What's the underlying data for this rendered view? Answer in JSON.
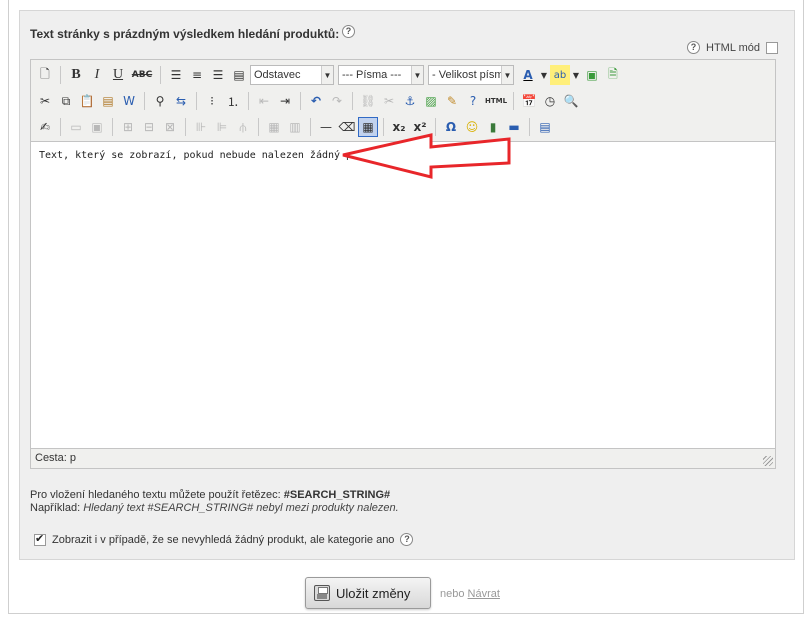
{
  "section": {
    "title": "Text stránky s prázdným výsledkem hledání produktů:",
    "help": "?"
  },
  "html_mode": {
    "label": "HTML mód",
    "help": "?",
    "checked": false
  },
  "toolbar": {
    "format_select": "Odstavec",
    "font_select": "--- Písma ---",
    "size_select": "- Velikost písma -",
    "row1_icons": [
      "new-document-icon",
      "bold-icon",
      "italic-icon",
      "underline-icon",
      "strikethrough-icon",
      "align-left-icon",
      "align-center-icon",
      "align-right-icon",
      "align-justify-icon"
    ],
    "bold_glyph": "B",
    "italic_glyph": "I",
    "underline_glyph": "U",
    "strike_glyph": "ABC"
  },
  "editor": {
    "content": "Text, který se zobrazí, pokud nebude nalezen žádný produkt.",
    "path_label": "Cesta: p"
  },
  "hint": {
    "prefix": "Pro vložení hledaného textu můžete použít řetězec: ",
    "token": "#SEARCH_STRING#",
    "example_prefix": "Například: ",
    "example": "Hledaný text #SEARCH_STRING# nebyl mezi produkty nalezen."
  },
  "show_option": {
    "label": "Zobrazit i v případě, že se nevyhledá žádný produkt, ale kategorie ano",
    "checked": true,
    "help": "?"
  },
  "actions": {
    "save_label": "Uložit změny",
    "or_label": "nebo",
    "back_label": "Návrat"
  },
  "colors": {
    "arrow": "#e8262a",
    "panel_bg": "#efefef",
    "toolbar_bg": "#f0f0ee"
  }
}
